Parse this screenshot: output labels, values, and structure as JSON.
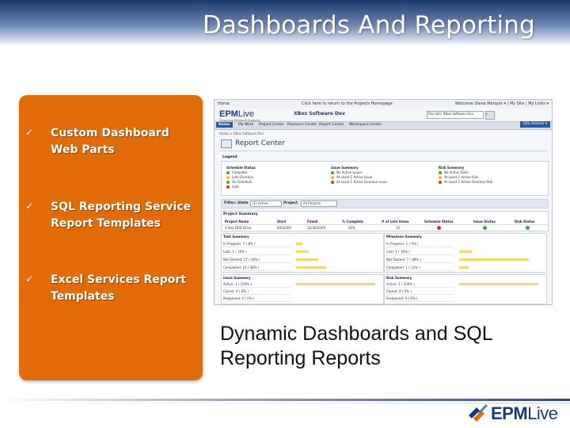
{
  "slide": {
    "title": "Dashboards And Reporting",
    "caption_line1": "Dynamic Dashboards and SQL",
    "caption_line2": "Reporting Reports"
  },
  "bullets": [
    {
      "line1": "Custom Dashboard",
      "line2": "Web Parts"
    },
    {
      "line1": "SQL Reporting Service",
      "line2": "Report Templates"
    },
    {
      "line1": "Excel Services Report",
      "line2": "Templates"
    }
  ],
  "check_glyph": "✓",
  "logo": {
    "epm": "EPM",
    "live": "Live",
    "icon": "epmlive-logo-icon"
  },
  "colors": {
    "panel": "#e36c0a",
    "header": "#1c3a6e",
    "accent": "#2c5aa0",
    "green": "#3aa83a",
    "yellow": "#e8c21a",
    "red": "#d9342b"
  },
  "screenshot": {
    "topline_left": "Home",
    "topline_middle": "Click here to return to the Projects Homepage",
    "topline_right": "Welcome Steve Marquis ▾ | My Site | My Links ▾",
    "brand_epm": "EPM",
    "brand_live": "Live",
    "brand_sub": "Enterprise Microsoft Products",
    "site_title": "XBox Software Dev",
    "search_value": "This Site: XBox Software Dev",
    "nav_tabs": [
      "Home",
      "My Work",
      "Project Center",
      "Resource Center",
      "Report Center",
      "Workspace Center"
    ],
    "site_actions": "Site Actions ▾",
    "breadcrumb": "Home > XBox Software Dev",
    "page_title": "Report Center",
    "legend_label": "Legend",
    "legend": {
      "schedule": {
        "header": "Schedule Status",
        "items": [
          "Complete",
          "Late Overdue",
          "On Schedule",
          "Late"
        ]
      },
      "issues": {
        "header": "Issue Summary",
        "items": [
          "No Active Issues",
          "At Least 1 Active Issue",
          "At Least 1 Active Overdue Issue"
        ]
      },
      "risks": {
        "header": "Risk Summary",
        "items": [
          "No Active Risks",
          "At Least 1 Active Risk",
          "At Least 1 Active Overdue Risk"
        ]
      }
    },
    "filter": {
      "state_label": "Filter: State",
      "state_value": "(1) Active",
      "project_label": "Project",
      "project_value": "All Projects"
    },
    "project_summary": {
      "label": "Project Summary",
      "headers": [
        "Project Name",
        "Start",
        "Finish",
        "% Complete",
        "# of Late Items",
        "Schedule Status",
        "Issue Status",
        "Risk Status"
      ],
      "row": [
        "X Box DVD Drive",
        "8/6/2009",
        "12/30/2009",
        "40%",
        "15"
      ]
    },
    "task_summary": {
      "label": "Task Summary",
      "rows": [
        "In Progress: 5 ( 8% )",
        "Late: 1 ( 16% )",
        "Not Started: 17 ( 28% )",
        "Completed: 10 ( 38% )"
      ],
      "values": [
        8,
        16,
        28,
        38
      ]
    },
    "milestone_summary": {
      "label": "Milestone Summary",
      "rows": [
        "In Progress: 1 ( 0% )",
        "Late: 1 ( 16% )",
        "Not Started: 7 ( 88% )",
        "Completed: 1 ( 12% )"
      ],
      "values": [
        0,
        16,
        88,
        12
      ]
    },
    "issue_summary": {
      "label": "Issue Summary",
      "rows": [
        "Active: 3 ( 100% )",
        "Closed: 0 ( 0% )",
        "Postponed: 0 ( 0% )"
      ],
      "values": [
        100,
        0,
        0
      ]
    },
    "risk_summary": {
      "label": "Risk Summary",
      "rows": [
        "Active: 3 ( 100% )",
        "Closed: 0 ( 0% )",
        "Postponed: 0 ( 0% )"
      ],
      "values": [
        100,
        0,
        0
      ]
    }
  }
}
